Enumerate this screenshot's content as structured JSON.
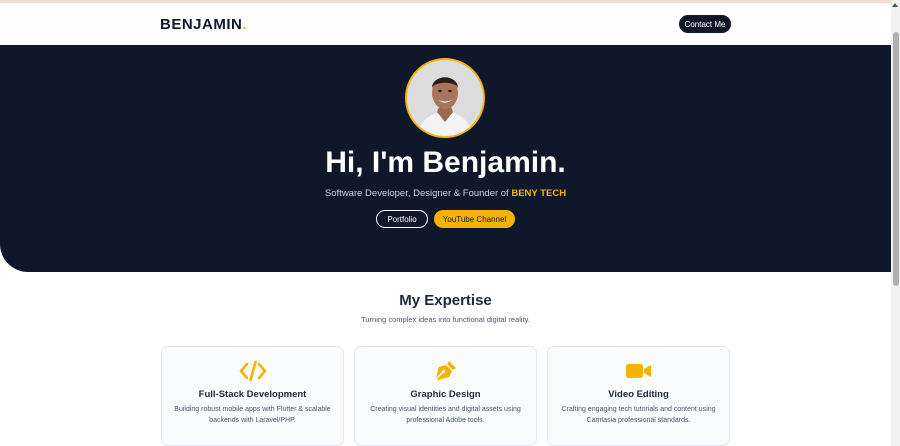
{
  "header": {
    "logo": "BENJAMIN",
    "logo_dot": ".",
    "contact_label": "Contact Me"
  },
  "hero": {
    "title": "Hi, I'm Benjamin.",
    "subtitle_prefix": "Software Developer, Designer & Founder of ",
    "subtitle_brand": "BENY TECH",
    "portfolio_label": "Portfolio",
    "youtube_label": "YouTube Channel"
  },
  "expertise": {
    "title": "My Expertise",
    "subtitle": "Turning complex ideas into functional digital reality.",
    "cards": [
      {
        "icon": "code-icon",
        "title": "Full-Stack Development",
        "desc": "Building robust mobile apps with Flutter & scalable backends with Laravel/PHP."
      },
      {
        "icon": "pen-nib-icon",
        "title": "Graphic Design",
        "desc": "Creating visual identities and digital assets using professional Adobe tools."
      },
      {
        "icon": "video-camera-icon",
        "title": "Video Editing",
        "desc": "Crafting engaging tech tutorials and content using Camtasia professional standards."
      }
    ]
  },
  "colors": {
    "accent": "#f5b301",
    "hero_bg": "#0f172a",
    "text_dark": "#1e293b"
  }
}
